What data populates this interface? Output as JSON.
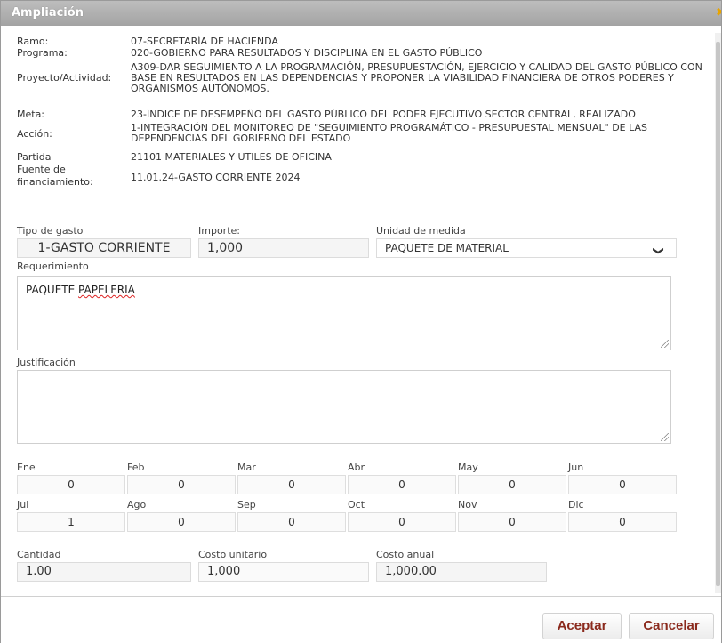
{
  "dialog": {
    "title": "Ampliación",
    "close_glyph": "✖"
  },
  "info": {
    "ramo_label": "Ramo:",
    "ramo_value": "07-SECRETARÍA DE HACIENDA",
    "programa_label": "Programa:",
    "programa_value": "020-GOBIERNO PARA RESULTADOS Y DISCIPLINA EN EL GASTO PÚBLICO",
    "proyecto_label": "Proyecto/Actividad:",
    "proyecto_value": "A309-DAR SEGUIMIENTO A LA PROGRAMACIÓN, PRESUPUESTACIÓN, EJERCICIO Y CALIDAD DEL GASTO PÚBLICO CON BASE EN RESULTADOS EN LAS DEPENDENCIAS Y PROPONER LA VIABILIDAD FINANCIERA DE OTROS PODERES Y ORGANISMOS AUTÓNOMOS.",
    "meta_label": "Meta:",
    "meta_value": "23-ÍNDICE DE DESEMPEÑO DEL GASTO PÚBLICO DEL PODER EJECUTIVO SECTOR CENTRAL, REALIZADO",
    "accion_label": "Acción:",
    "accion_value": "1-INTEGRACIÓN DEL MONITOREO DE \"SEGUIMIENTO PROGRAMÁTICO - PRESUPUESTAL MENSUAL\" DE LAS DEPENDENCIAS DEL GOBIERNO DEL ESTADO",
    "partida_label": "Partida",
    "partida_value": "21101 MATERIALES Y UTILES DE OFICINA",
    "fuente_label_1": "Fuente de",
    "fuente_label_2": "financiamiento:",
    "fuente_value": "11.01.24-GASTO CORRIENTE 2024"
  },
  "form": {
    "tipo_gasto_label": "Tipo de gasto",
    "tipo_gasto_value": "1-GASTO CORRIENTE",
    "importe_label": "Importe:",
    "importe_value": "1,000",
    "unidad_label": "Unidad de medida",
    "unidad_value": "PAQUETE DE MATERIAL",
    "unidad_arrow": "❯",
    "requerimiento_label": "Requerimiento",
    "requerimiento_word1": "PAQUETE",
    "requerimiento_word2": "PAPELERIA",
    "justificacion_label": "Justificación",
    "cantidad_label": "Cantidad",
    "cantidad_value": "1.00",
    "costo_unitario_label": "Costo unitario",
    "costo_unitario_value": "1,000",
    "costo_anual_label": "Costo anual",
    "costo_anual_value": "1,000.00"
  },
  "months": [
    {
      "label": "Ene",
      "value": "0"
    },
    {
      "label": "Feb",
      "value": "0"
    },
    {
      "label": "Mar",
      "value": "0"
    },
    {
      "label": "Abr",
      "value": "0"
    },
    {
      "label": "May",
      "value": "0"
    },
    {
      "label": "Jun",
      "value": "0"
    },
    {
      "label": "Jul",
      "value": "1"
    },
    {
      "label": "Ago",
      "value": "0"
    },
    {
      "label": "Sep",
      "value": "0"
    },
    {
      "label": "Oct",
      "value": "0"
    },
    {
      "label": "Nov",
      "value": "0"
    },
    {
      "label": "Dic",
      "value": "0"
    }
  ],
  "buttons": {
    "accept": "Aceptar",
    "cancel": "Cancelar"
  },
  "colors": {
    "button_text": "#8b2a1d",
    "close_icon": "#e8a400"
  }
}
